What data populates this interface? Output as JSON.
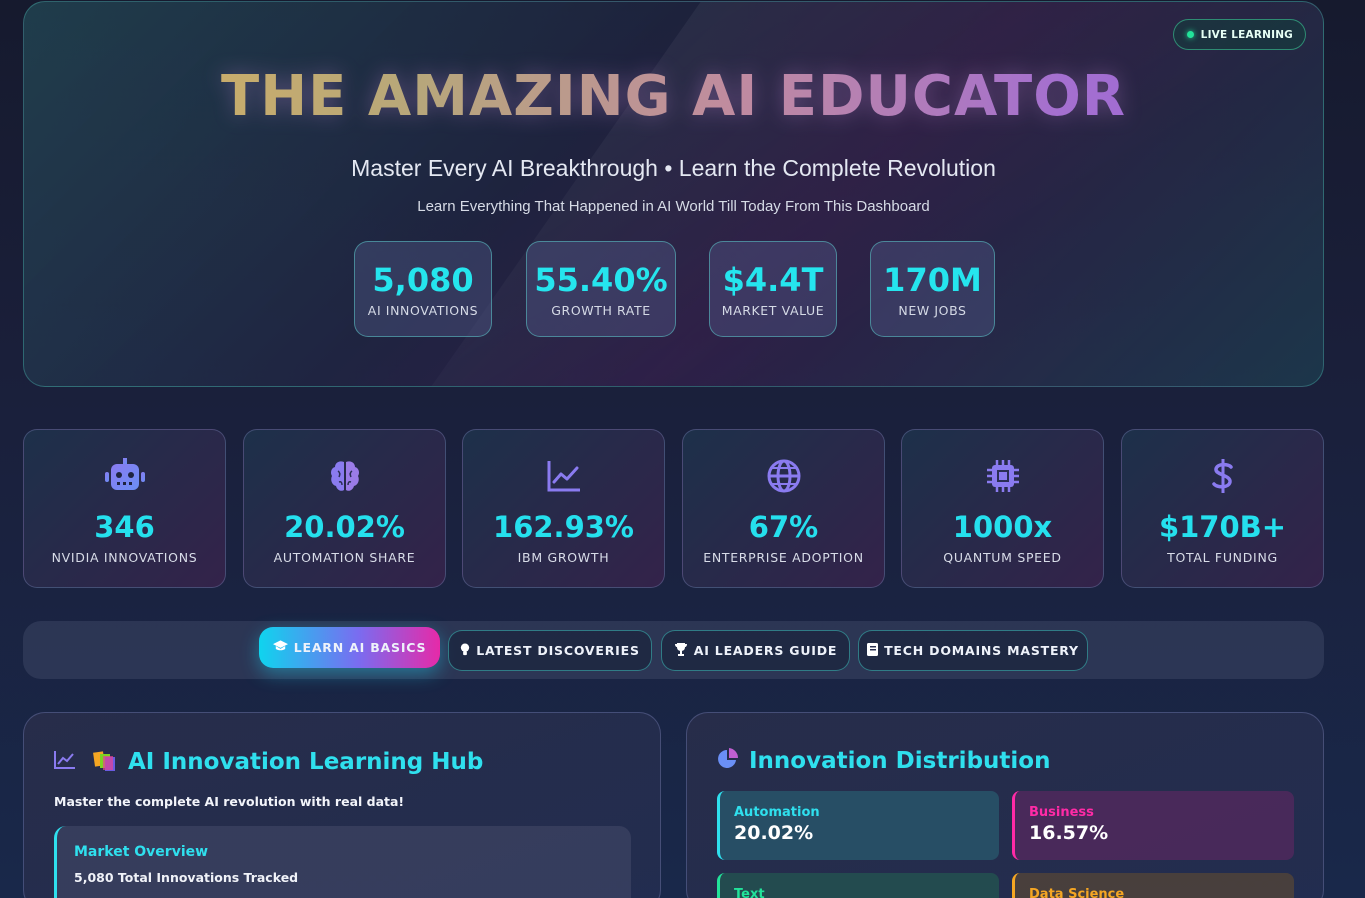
{
  "hero": {
    "live_badge": "LIVE LEARNING",
    "title": "THE AMAZING AI EDUCATOR",
    "subtitle": "Master Every AI Breakthrough • Learn the Complete Revolution",
    "tagline": "Learn Everything That Happened in AI World Till Today From This Dashboard",
    "stats": [
      {
        "value": "5,080",
        "label": "AI INNOVATIONS"
      },
      {
        "value": "55.40%",
        "label": "GROWTH RATE"
      },
      {
        "value": "$4.4T",
        "label": "MARKET VALUE"
      },
      {
        "value": "170M",
        "label": "NEW JOBS"
      }
    ]
  },
  "metrics": [
    {
      "icon": "robot-icon",
      "value": "346",
      "label": "NVIDIA INNOVATIONS"
    },
    {
      "icon": "brain-icon",
      "value": "20.02%",
      "label": "AUTOMATION SHARE"
    },
    {
      "icon": "chart-line-icon",
      "value": "162.93%",
      "label": "IBM GROWTH"
    },
    {
      "icon": "globe-icon",
      "value": "67%",
      "label": "ENTERPRISE ADOPTION"
    },
    {
      "icon": "chip-icon",
      "value": "1000x",
      "label": "QUANTUM SPEED"
    },
    {
      "icon": "dollar-icon",
      "value": "$170B+",
      "label": "TOTAL FUNDING"
    }
  ],
  "tabs": [
    {
      "icon": "graduation-cap-icon",
      "label": "LEARN AI BASICS",
      "active": true
    },
    {
      "icon": "lightbulb-icon",
      "label": "LATEST DISCOVERIES",
      "active": false
    },
    {
      "icon": "trophy-icon",
      "label": "AI LEADERS GUIDE",
      "active": false
    },
    {
      "icon": "book-icon",
      "label": "TECH DOMAINS MASTERY",
      "active": false
    }
  ],
  "learning_hub": {
    "title": "AI Innovation Learning Hub",
    "description": "Master the complete AI revolution with real data!",
    "market_overview": {
      "heading": "Market Overview",
      "summary": "5,080 Total Innovations Tracked"
    }
  },
  "distribution": {
    "title": "Innovation Distribution",
    "items": [
      {
        "name": "Automation",
        "percent": "20.02%",
        "color": "#2fe0ee"
      },
      {
        "name": "Business",
        "percent": "16.57%",
        "color": "#ff2aa6"
      },
      {
        "name": "Text",
        "percent": "",
        "color": "#22e39a"
      },
      {
        "name": "Data Science",
        "percent": "",
        "color": "#f5a623"
      }
    ]
  },
  "colors": {
    "accent_cyan": "#25e5ee",
    "accent_magenta": "#e62aa8",
    "icon_purple": "#8a7bf0",
    "live_green": "#22e39a"
  }
}
